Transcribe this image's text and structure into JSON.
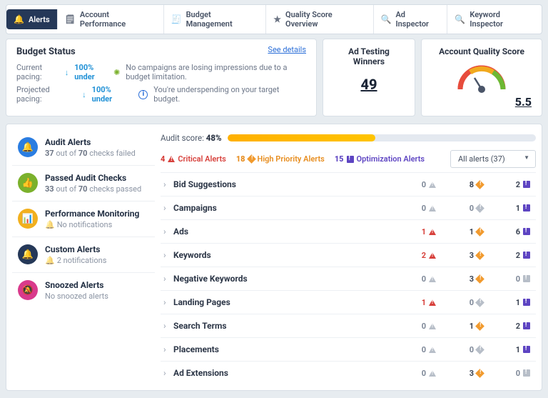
{
  "tabs": [
    {
      "label": "Alerts",
      "active": true
    },
    {
      "label": "Account Performance",
      "active": false
    },
    {
      "label": "Budget Management",
      "active": false
    },
    {
      "label": "Quality Score Overview",
      "active": false
    },
    {
      "label": "Ad Inspector",
      "active": false
    },
    {
      "label": "Keyword Inspector",
      "active": false
    }
  ],
  "budget": {
    "title": "Budget Status",
    "see_details": "See details",
    "line1_label": "Current pacing:",
    "line1_value": "100% under",
    "line1_msg": "No campaigns are losing impressions due to a budget limitation.",
    "line2_label": "Projected pacing:",
    "line2_value": "100% under",
    "line2_msg": "You're underspending on your target budget."
  },
  "winners": {
    "title": "Ad Testing Winners",
    "value": "49"
  },
  "qscore": {
    "title": "Account Quality Score",
    "value": "5.5"
  },
  "side": [
    {
      "title": "Audit Alerts",
      "sub_html": "<b>37</b> out of <b>70</b> checks failed",
      "color": "#2a7de1",
      "icon": "bell",
      "muteicon": false
    },
    {
      "title": "Passed Audit Checks",
      "sub_html": "<b>33</b> out of <b>70</b> checks passed",
      "color": "#7bb12c",
      "icon": "thumb",
      "muteicon": false
    },
    {
      "title": "Performance Monitoring",
      "sub_html": "<span class=\"muteico\">🔔</span>No notifications",
      "color": "#f2b01e",
      "icon": "chart",
      "muteicon": true
    },
    {
      "title": "Custom Alerts",
      "sub_html": "<span class=\"muteico\">🔔</span>2 notifications",
      "color": "#253858",
      "icon": "bell",
      "muteicon": true
    },
    {
      "title": "Snoozed Alerts",
      "sub_html": "No snoozed alerts",
      "color": "#d93a8c",
      "icon": "mute",
      "muteicon": false
    }
  ],
  "audit": {
    "label": "Audit score:",
    "value": "48%",
    "pct": 48
  },
  "filter": {
    "critical": {
      "count": "4",
      "label": "Critical Alerts"
    },
    "high": {
      "count": "18",
      "label": "High Priority Alerts"
    },
    "opt": {
      "count": "15",
      "label": "Optimization Alerts"
    },
    "dropdown": "All alerts (37)"
  },
  "rows": [
    {
      "name": "Bid Suggestions",
      "c": 0,
      "h": 8,
      "o": 2
    },
    {
      "name": "Campaigns",
      "c": 0,
      "h": 0,
      "o": 1
    },
    {
      "name": "Ads",
      "c": 1,
      "h": 1,
      "o": 6
    },
    {
      "name": "Keywords",
      "c": 2,
      "h": 3,
      "o": 2
    },
    {
      "name": "Negative Keywords",
      "c": 0,
      "h": 3,
      "o": 0
    },
    {
      "name": "Landing Pages",
      "c": 1,
      "h": 0,
      "o": 1
    },
    {
      "name": "Search Terms",
      "c": 0,
      "h": 1,
      "o": 2
    },
    {
      "name": "Placements",
      "c": 0,
      "h": 0,
      "o": 1
    },
    {
      "name": "Ad Extensions",
      "c": 0,
      "h": 3,
      "o": 0
    }
  ]
}
